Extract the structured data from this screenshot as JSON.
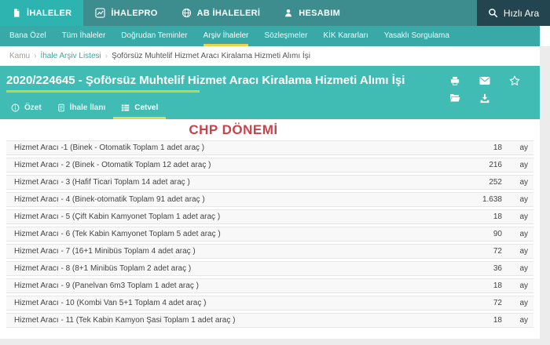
{
  "topnav": {
    "items": [
      {
        "label": "İHALELER",
        "icon": "file-icon",
        "active": true
      },
      {
        "label": "İHALEPRO",
        "icon": "chart-icon"
      },
      {
        "label": "AB İHALELERİ",
        "icon": "globe-icon"
      },
      {
        "label": "HESABIM",
        "icon": "user-icon"
      }
    ],
    "search_label": "Hızlı Ara"
  },
  "subnav": {
    "items": [
      {
        "label": "Bana Özel"
      },
      {
        "label": "Tüm İhaleler"
      },
      {
        "label": "Doğrudan Teminler"
      },
      {
        "label": "Arşiv İhaleler",
        "active": true
      },
      {
        "label": "Sözleşmeler"
      },
      {
        "label": "KİK Kararları"
      },
      {
        "label": "Yasaklı Sorgulama"
      }
    ]
  },
  "breadcrumb": {
    "items": [
      "Kamu",
      "İhale Arşiv Listesi",
      "Şoförsüz Muhtelif Hizmet Aracı Kiralama Hizmeti Alımı İşi"
    ],
    "separator": "›"
  },
  "header": {
    "title": "2020/224645 - Şoförsüz Muhtelif Hizmet Aracı Kiralama Hizmeti Alımı İşi",
    "action_icons": [
      "printer-icon",
      "envelope-icon",
      "star-icon",
      "folder-icon",
      "download-icon"
    ]
  },
  "tabs": [
    {
      "label": "Özet",
      "icon": "info-icon"
    },
    {
      "label": "İhale İlanı",
      "icon": "document-icon"
    },
    {
      "label": "Cetvel",
      "icon": "table-icon",
      "active": true
    }
  ],
  "annotation": "CHP DÖNEMİ",
  "table": {
    "rows": [
      {
        "name": "Hizmet Aracı -1 (Binek - Otomatik Toplam 1 adet araç )",
        "qty": "18",
        "unit": "ay"
      },
      {
        "name": "Hizmet Aracı - 2 (Binek - Otomatik Toplam 12 adet araç )",
        "qty": "216",
        "unit": "ay"
      },
      {
        "name": "Hizmet Aracı - 3 (Hafif Ticari Toplam 14 adet araç )",
        "qty": "252",
        "unit": "ay"
      },
      {
        "name": "Hizmet Aracı - 4 (Binek-otomatik Toplam 91 adet araç )",
        "qty": "1.638",
        "unit": "ay"
      },
      {
        "name": "Hizmet Aracı - 5 (Çift Kabin Kamyonet Toplam 1 adet araç )",
        "qty": "18",
        "unit": "ay"
      },
      {
        "name": "Hizmet Aracı - 6 (Tek Kabin Kamyonet Toplam 5 adet araç )",
        "qty": "90",
        "unit": "ay"
      },
      {
        "name": "Hizmet Aracı - 7 (16+1 Minibüs Toplam 4 adet araç )",
        "qty": "72",
        "unit": "ay"
      },
      {
        "name": "Hizmet Aracı - 8 (8+1 Minibüs Toplam 2 adet araç )",
        "qty": "36",
        "unit": "ay"
      },
      {
        "name": "Hizmet Aracı - 9 (Panelvan 6m3 Toplam 1 adet araç )",
        "qty": "18",
        "unit": "ay"
      },
      {
        "name": "Hizmet Aracı - 10 (Kombi Van 5+1 Toplam 4 adet araç )",
        "qty": "72",
        "unit": "ay"
      },
      {
        "name": "Hizmet Aracı - 11 (Tek Kabin Kamyon Şasi Toplam 1 adet araç )",
        "qty": "18",
        "unit": "ay"
      }
    ]
  },
  "colors": {
    "topbar": "#3d8d8f",
    "topbar_active": "#2db4b0",
    "subnav": "#38a9a6",
    "band": "#41bcb4",
    "search_dark": "#22454f",
    "yellow": "#e9d34f",
    "green_underline": "#b8d94b",
    "red": "#c8434b",
    "link_teal": "#3aa79f",
    "crumb_tan": "#a59d90",
    "page_gray": "#ececec",
    "row_bg": "#f8f8f8",
    "row_border": "#e7e7e7",
    "text_dark": "#444444"
  }
}
